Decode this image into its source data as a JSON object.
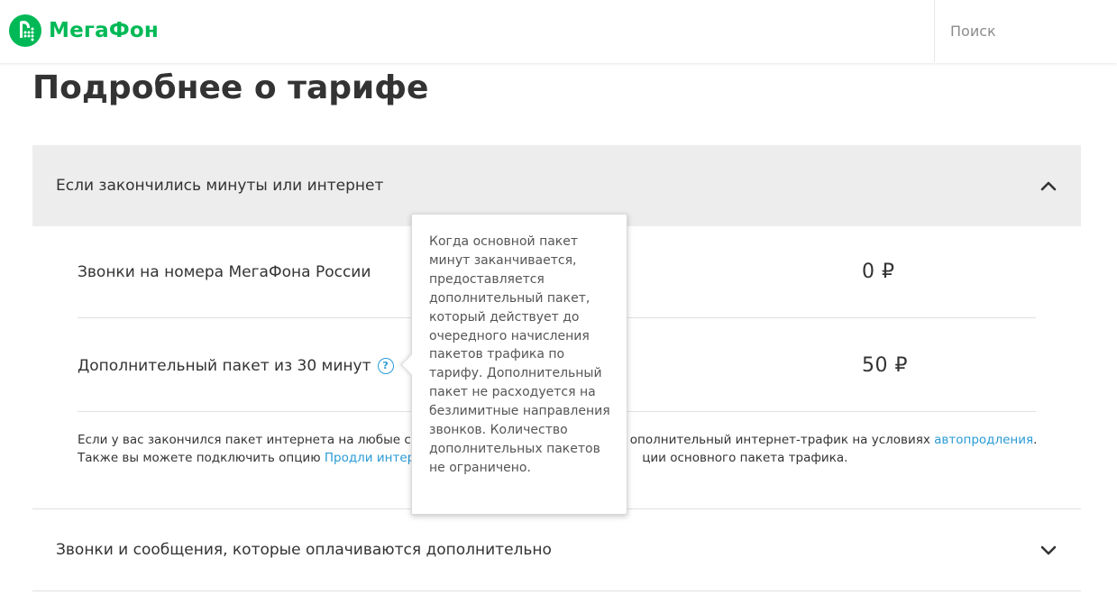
{
  "header": {
    "logo_text": "МегаФон",
    "search_placeholder": "Поиск",
    "brand_color": "#00b956"
  },
  "page": {
    "title": "Подробнее о тарифе"
  },
  "accordions": [
    {
      "title": "Если закончились минуты или интернет",
      "expanded": true,
      "rows": [
        {
          "label": "Звонки на номера МегаФона России",
          "price": "0 ₽"
        },
        {
          "label": "Дополнительный пакет из 30 минут",
          "price": "50 ₽",
          "help_icon": "?"
        }
      ],
      "note": {
        "p1": "Если у вас закончился пакет интернета на любые с",
        "p2": "ополнительный интернет-трафик на условиях ",
        "link1": "автопродления",
        "p3": ".",
        "p4": "Также вы можете подключить опцию ",
        "link2": "Продли интер",
        "p5": "ции основного пакета трафика."
      }
    },
    {
      "title": "Звонки и сообщения, которые оплачиваются дополнительно",
      "expanded": false
    }
  ],
  "tooltip": {
    "text": "Когда основной пакет минут заканчивается, предоставляется дополнительный пакет, который действует до очередного начисления пакетов трафика по тарифу. Дополнительный пакет не расходуется на безлимитные направления звонков. Количество дополнительных пакетов не ограничено."
  },
  "icons": {
    "logo": "megafon-logo-icon",
    "collapse": "chevron-up-icon",
    "expand": "chevron-down-icon",
    "help": "question-icon"
  },
  "colors": {
    "link": "#2a9bd6",
    "accordion_bg": "#ededed"
  }
}
